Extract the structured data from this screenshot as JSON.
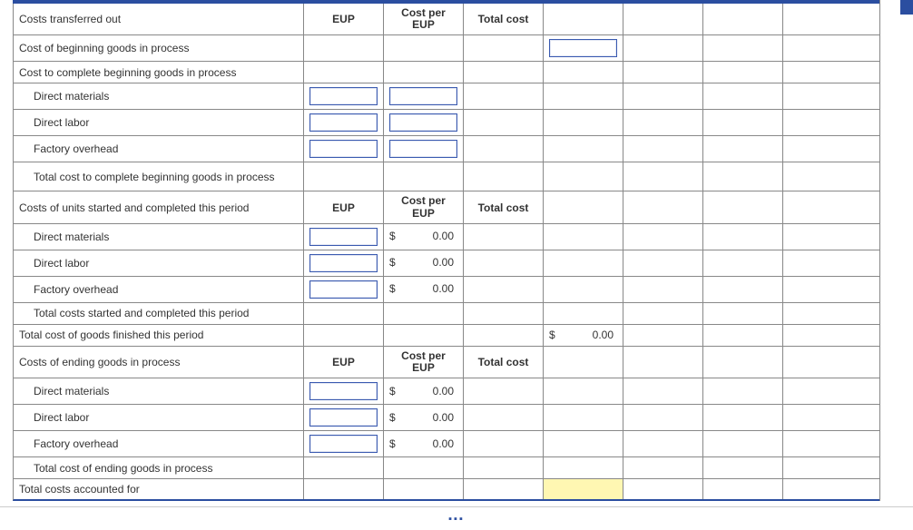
{
  "section_header_partial": "",
  "headers": {
    "eup": "EUP",
    "cost_per_eup": "Cost per EUP",
    "total_cost": "Total cost"
  },
  "rows": {
    "costs_transferred_out": "Costs transferred out",
    "cost_beginning_gip": "Cost of beginning goods in process",
    "cost_complete_beg_gip": "Cost to complete beginning goods in process",
    "dm": "Direct materials",
    "dl": "Direct labor",
    "foh": "Factory overhead",
    "total_complete_beg_gip": "Total cost to complete beginning goods in process",
    "costs_started_completed": "Costs of units started and completed this period",
    "total_started_completed": "Total costs started and completed this period",
    "total_finished": "Total cost of goods finished this period",
    "costs_ending_gip": "Costs of ending goods in process",
    "total_ending_gip": "Total cost of ending goods in process",
    "total_accounted": "Total costs accounted for"
  },
  "values": {
    "zero": "0.00",
    "dollar": "$"
  }
}
